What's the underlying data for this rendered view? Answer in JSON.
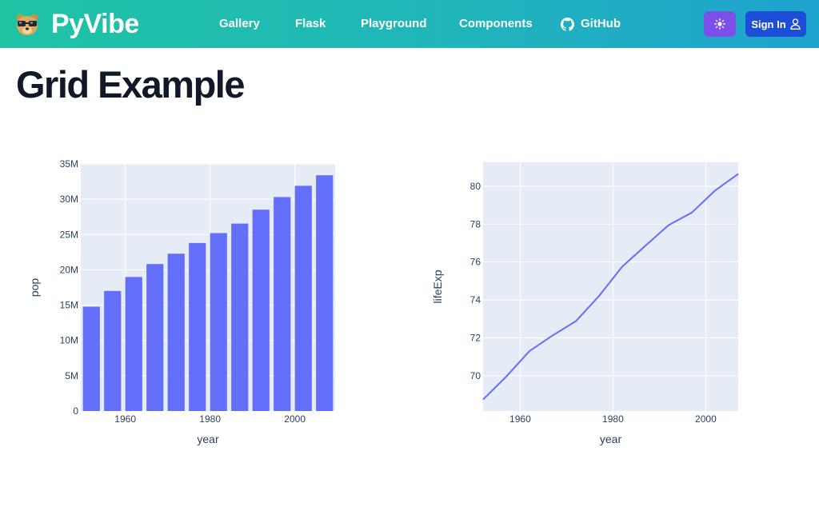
{
  "app": {
    "brand": "PyVibe",
    "logo_icon": "glasses-bear-icon"
  },
  "nav": {
    "links": [
      {
        "label": "Gallery"
      },
      {
        "label": "Flask"
      },
      {
        "label": "Playground"
      },
      {
        "label": "Components"
      },
      {
        "label": "GitHub",
        "icon": "github-icon"
      }
    ],
    "theme_toggle_icon": "sun-icon",
    "signin_label": "Sign In",
    "signin_icon": "user-icon"
  },
  "page": {
    "title": "Grid Example"
  },
  "colors": {
    "nav_gradient": [
      "#1fc3a4",
      "#1fa3cf"
    ],
    "plot_bg": "#e5ecf6",
    "series": "#636efa",
    "theme_button": "#7c4fe8",
    "signin_button": "#1d4ed8"
  },
  "chart_data": [
    {
      "type": "bar",
      "x": [
        1952,
        1957,
        1962,
        1967,
        1972,
        1977,
        1982,
        1987,
        1992,
        1997,
        2002,
        2007
      ],
      "values": [
        14785584,
        17010154,
        18985849,
        20819767,
        22284500,
        23796400,
        25201900,
        26549700,
        28523502,
        30305843,
        31902268,
        33390141
      ],
      "xlabel": "year",
      "ylabel": "pop",
      "xlim": [
        1949.5,
        2009.5
      ],
      "ylim": [
        0,
        35000000
      ],
      "xticks": [
        1960,
        1980,
        2000
      ],
      "xtick_labels": [
        "1960",
        "1980",
        "2000"
      ],
      "yticks": [
        0,
        5000000,
        10000000,
        15000000,
        20000000,
        25000000,
        30000000,
        35000000
      ],
      "ytick_labels": [
        "0",
        "5M",
        "10M",
        "15M",
        "20M",
        "25M",
        "30M",
        "35M"
      ],
      "grid": true
    },
    {
      "type": "line",
      "x": [
        1952,
        1957,
        1962,
        1967,
        1972,
        1977,
        1982,
        1987,
        1992,
        1997,
        2002,
        2007
      ],
      "values": [
        68.75,
        69.96,
        71.3,
        72.13,
        72.88,
        74.21,
        75.76,
        76.86,
        77.95,
        78.61,
        79.77,
        80.653
      ],
      "xlabel": "year",
      "ylabel": "lifeExp",
      "xlim": [
        1952,
        2007
      ],
      "ylim": [
        68.14,
        81.26
      ],
      "xticks": [
        1960,
        1980,
        2000
      ],
      "xtick_labels": [
        "1960",
        "1980",
        "2000"
      ],
      "yticks": [
        70,
        72,
        74,
        76,
        78,
        80
      ],
      "ytick_labels": [
        "70",
        "72",
        "74",
        "76",
        "78",
        "80"
      ],
      "grid": true
    }
  ]
}
